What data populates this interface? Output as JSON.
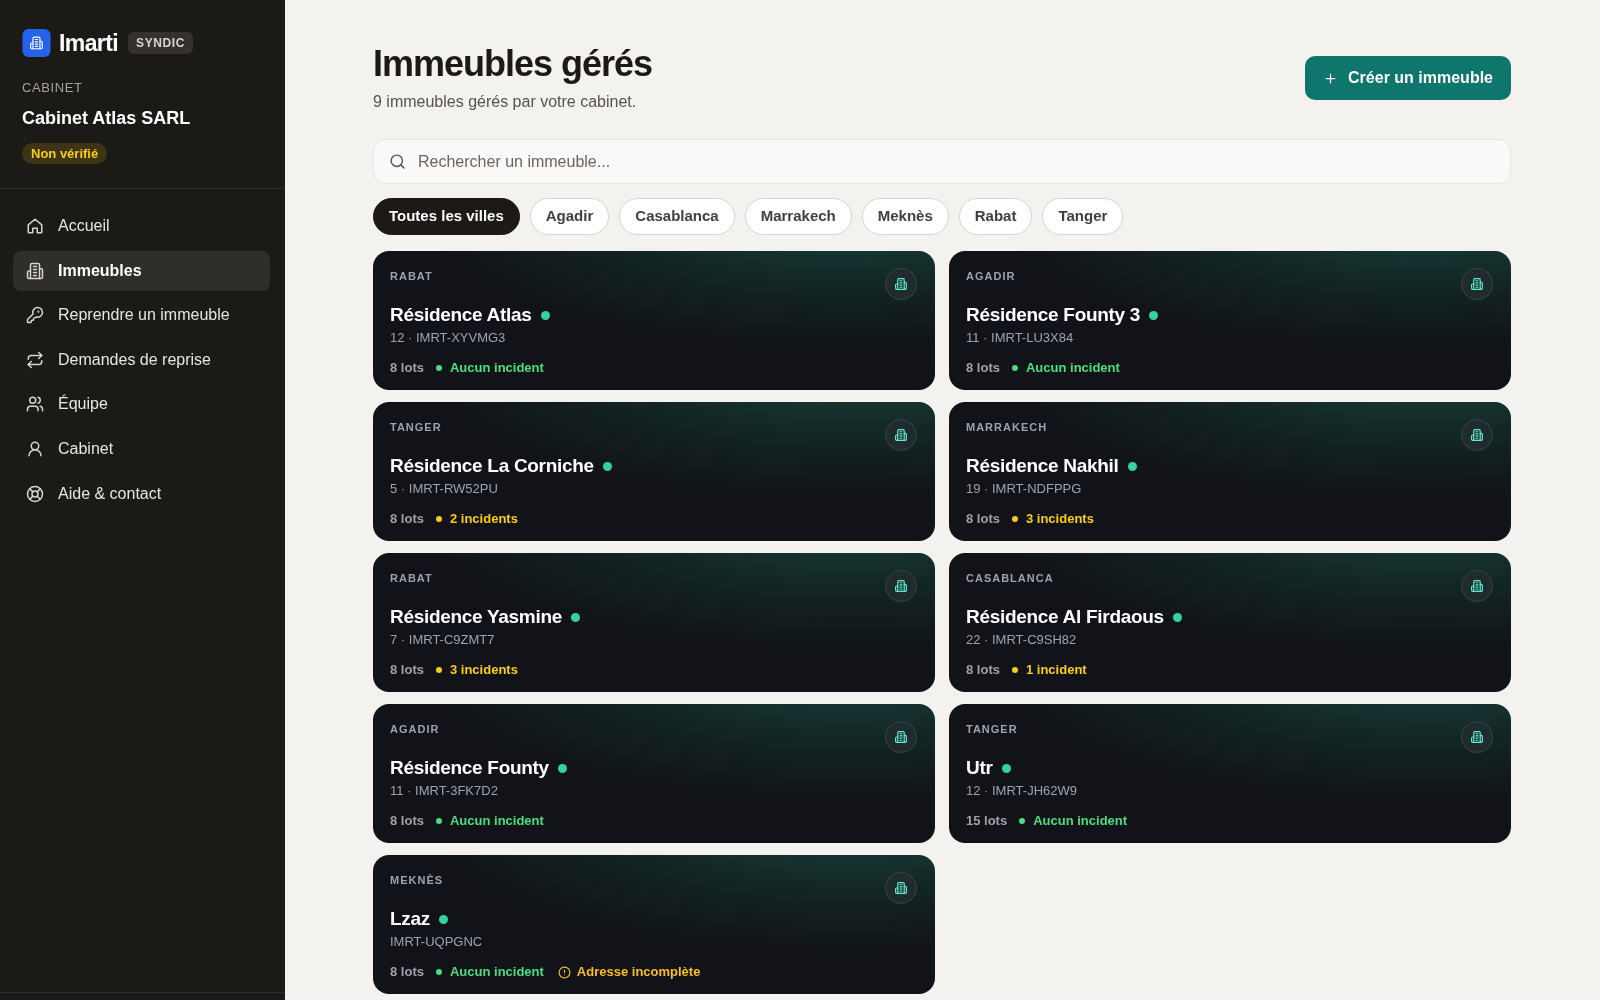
{
  "sidebar": {
    "brand": {
      "name": "Imarti",
      "badge": "SYNDIC"
    },
    "org_label": "CABINET",
    "org_name": "Cabinet Atlas SARL",
    "org_status": "Non vérifié",
    "nav": [
      {
        "label": "Accueil",
        "selected": false
      },
      {
        "label": "Immeubles",
        "selected": true
      },
      {
        "label": "Reprendre un immeuble",
        "selected": false
      },
      {
        "label": "Demandes de reprise",
        "selected": false
      },
      {
        "label": "Équipe",
        "selected": false
      },
      {
        "label": "Cabinet",
        "selected": false
      },
      {
        "label": "Aide & contact",
        "selected": false
      }
    ]
  },
  "header": {
    "title": "Immeubles gérés",
    "subtitle": "9 immeubles gérés par votre cabinet.",
    "create_button": "Créer un immeuble"
  },
  "search": {
    "placeholder": "Rechercher un immeuble..."
  },
  "filters": [
    {
      "label": "Toutes les villes",
      "selected": true
    },
    {
      "label": "Agadir",
      "selected": false
    },
    {
      "label": "Casablanca",
      "selected": false
    },
    {
      "label": "Marrakech",
      "selected": false
    },
    {
      "label": "Meknès",
      "selected": false
    },
    {
      "label": "Rabat",
      "selected": false
    },
    {
      "label": "Tanger",
      "selected": false
    }
  ],
  "buildings": [
    {
      "city": "RABAT",
      "name": "Résidence Atlas",
      "active": true,
      "meta": "12 · IMRT-XYVMG3",
      "lots": "8 lots",
      "incidents": {
        "kind": "none",
        "text": "Aucun incident"
      }
    },
    {
      "city": "AGADIR",
      "name": "Résidence Founty 3",
      "active": true,
      "meta": "11 · IMRT-LU3X84",
      "lots": "8 lots",
      "incidents": {
        "kind": "none",
        "text": "Aucun incident"
      }
    },
    {
      "city": "TANGER",
      "name": "Résidence La Corniche",
      "active": true,
      "meta": "5 · IMRT-RW52PU",
      "lots": "8 lots",
      "incidents": {
        "kind": "open",
        "text": "2 incidents"
      }
    },
    {
      "city": "MARRAKECH",
      "name": "Résidence Nakhil",
      "active": true,
      "meta": "19 · IMRT-NDFPPG",
      "lots": "8 lots",
      "incidents": {
        "kind": "open",
        "text": "3 incidents"
      }
    },
    {
      "city": "RABAT",
      "name": "Résidence Yasmine",
      "active": true,
      "meta": "7 · IMRT-C9ZMT7",
      "lots": "8 lots",
      "incidents": {
        "kind": "open",
        "text": "3 incidents"
      }
    },
    {
      "city": "CASABLANCA",
      "name": "Résidence Al Firdaous",
      "active": true,
      "meta": "22 · IMRT-C9SH82",
      "lots": "8 lots",
      "incidents": {
        "kind": "open",
        "text": "1 incident"
      }
    },
    {
      "city": "AGADIR",
      "name": "Résidence Founty",
      "active": true,
      "meta": "11 · IMRT-3FK7D2",
      "lots": "8 lots",
      "incidents": {
        "kind": "none",
        "text": "Aucun incident"
      }
    },
    {
      "city": "TANGER",
      "name": "Utr",
      "active": true,
      "meta": "12 · IMRT-JH62W9",
      "lots": "15 lots",
      "incidents": {
        "kind": "none",
        "text": "Aucun incident"
      }
    },
    {
      "city": "MEKNÈS",
      "name": "Lzaz",
      "active": true,
      "meta": "IMRT-UQPGNC",
      "lots": "8 lots",
      "incidents": {
        "kind": "none",
        "text": "Aucun incident"
      },
      "warning": "Adresse incomplète"
    }
  ]
}
